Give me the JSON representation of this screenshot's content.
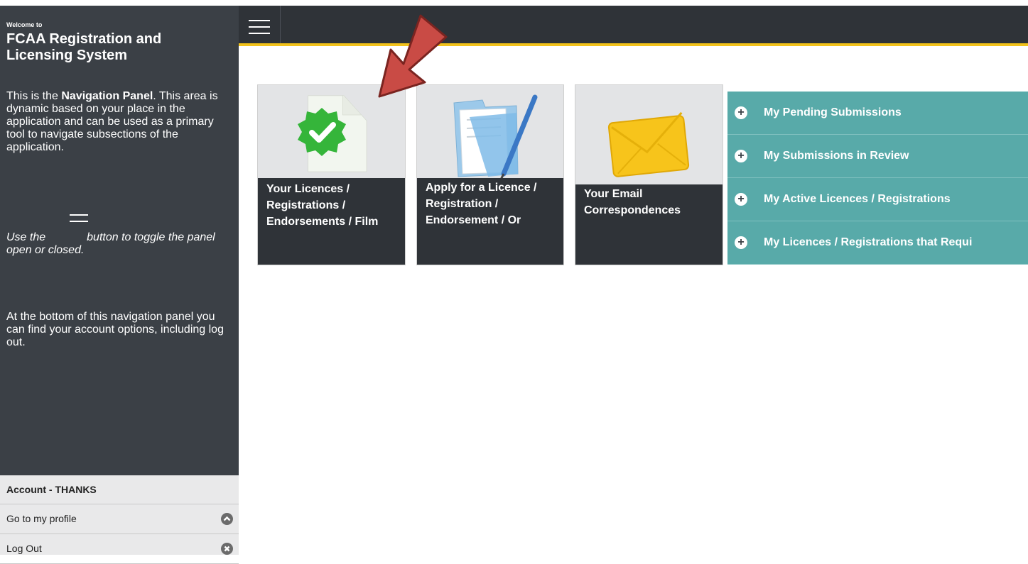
{
  "sidebar": {
    "welcome": "Welcome to",
    "title": "FCAA Registration and Licensing System",
    "intro_prefix": "This is the ",
    "intro_bold": "Navigation Panel",
    "intro_rest": ". This area is dynamic based on your place in the application and can be used as a primary tool to navigate subsections of the application.",
    "toggle_prefix": "Use the",
    "toggle_suffix": "button to toggle the panel open or closed.",
    "bottom_text": "At the bottom of this navigation panel you can find your account options, including log out."
  },
  "account": {
    "header": "Account - THANKS",
    "profile_label": "Go to my profile",
    "logout_label": "Log Out"
  },
  "tiles": [
    {
      "label": "Your Licences / Registrations / Endorsements / Film"
    },
    {
      "label": "Apply for a Licence / Registration / Endorsement / Or"
    },
    {
      "label": "Your Email Correspondences"
    }
  ],
  "accordion": [
    {
      "label": "My Pending Submissions"
    },
    {
      "label": "My Submissions in Review"
    },
    {
      "label": "My Active Licences / Registrations"
    },
    {
      "label": "My Licences / Registrations that Requi"
    }
  ],
  "colors": {
    "sidebar_bg": "#3b4046",
    "topbar_bg": "#2f3338",
    "accent_yellow": "#f2c21b",
    "accordion_bg": "#58aaa9",
    "arrow_red": "#c94b45"
  },
  "icons": {
    "menu": "hamburger-icon",
    "profile": "chevron-up-icon",
    "logout": "close-icon",
    "licences_tile": "check-document-icon",
    "apply_tile": "folder-pen-icon",
    "email_tile": "envelope-icon",
    "accordion_expand": "plus-icon"
  }
}
